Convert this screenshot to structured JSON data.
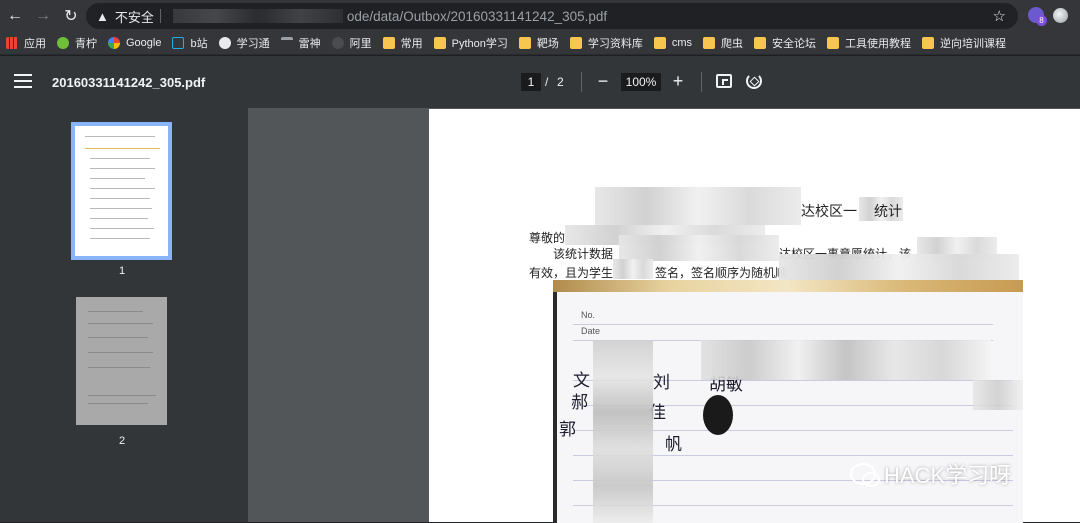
{
  "browser": {
    "security_label": "不安全",
    "url": "ode/data/Outbox/20160331141242_305.pdf",
    "extension_badge": "8"
  },
  "bookmarks": [
    {
      "label": "应用",
      "icon": "apps-grid-icon"
    },
    {
      "label": "青柠",
      "icon": "lemon-icon"
    },
    {
      "label": "Google",
      "icon": "google-icon"
    },
    {
      "label": "b站",
      "icon": "bilibili-icon"
    },
    {
      "label": "学习通",
      "icon": "globe-icon"
    },
    {
      "label": "雷神",
      "icon": "hammer-icon"
    },
    {
      "label": "阿里",
      "icon": "aliyun-icon"
    },
    {
      "label": "常用",
      "icon": "folder-icon"
    },
    {
      "label": "Python学习",
      "icon": "folder-icon"
    },
    {
      "label": "靶场",
      "icon": "folder-icon"
    },
    {
      "label": "学习资料库",
      "icon": "folder-icon"
    },
    {
      "label": "cms",
      "icon": "folder-icon"
    },
    {
      "label": "爬虫",
      "icon": "folder-icon"
    },
    {
      "label": "安全论坛",
      "icon": "folder-icon"
    },
    {
      "label": "工具使用教程",
      "icon": "folder-icon"
    },
    {
      "label": "逆向培训课程",
      "icon": "folder-icon"
    }
  ],
  "pdf": {
    "filename": "20160331141242_305.pdf",
    "current_page": "1",
    "page_separator": "/",
    "total_pages": "2",
    "zoom": "100%",
    "zoom_out": "−",
    "zoom_in": "+",
    "thumbnails": [
      {
        "label": "1",
        "selected": true
      },
      {
        "label": "2",
        "selected": false
      }
    ]
  },
  "document": {
    "title_visible": "达校区一",
    "title_end": "统计",
    "line1_start": "尊敬的",
    "line2_start": "该统计数据",
    "line2_mid": "达校区一事意愿统计，该",
    "line3": "有效，且为学生",
    "line3_b": "签名，签名顺序为随机顺",
    "photo_header_no": "No.",
    "photo_header_date": "Date"
  },
  "watermark": {
    "text": "HACK学习呀"
  }
}
